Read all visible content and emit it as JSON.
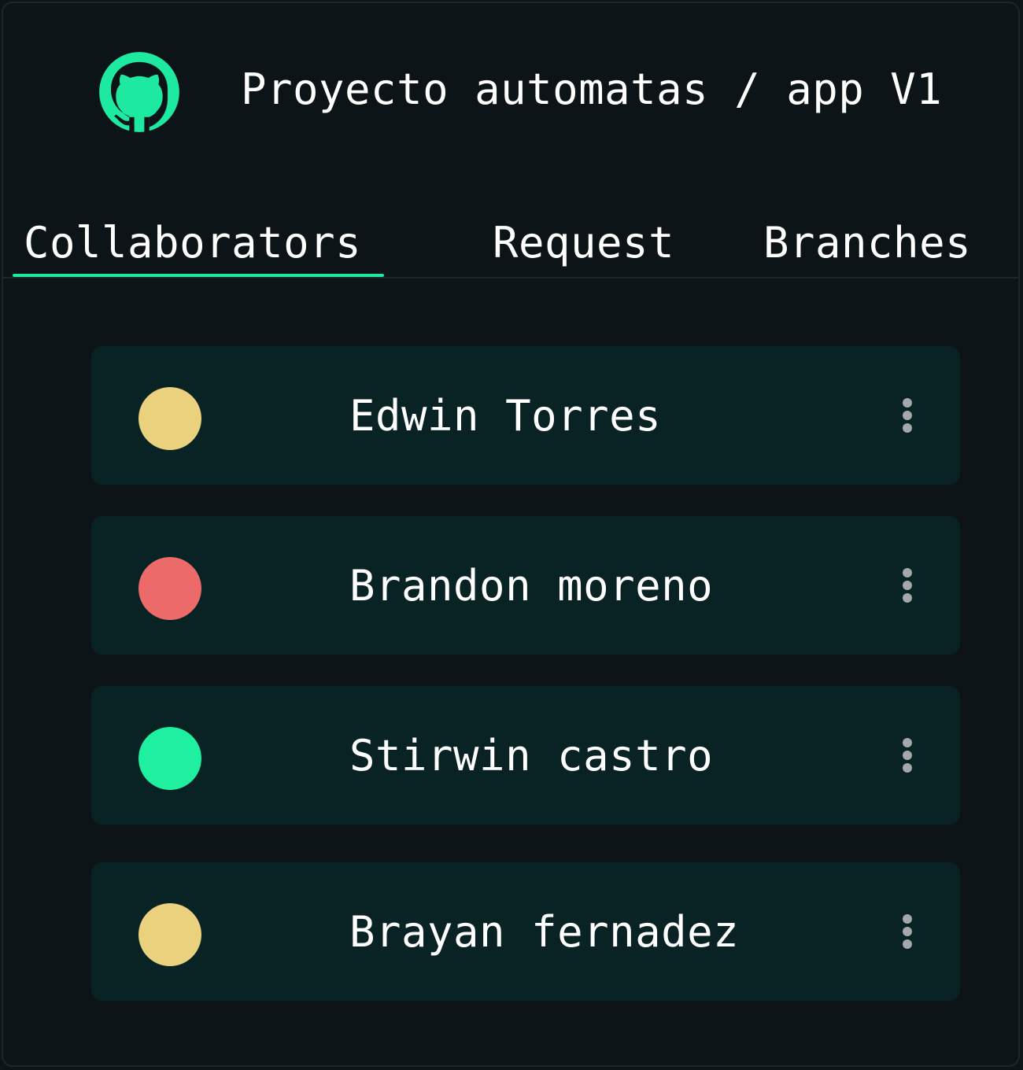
{
  "header": {
    "logo_icon": "github-icon",
    "title": "Proyecto automatas / app V1"
  },
  "tabs": [
    {
      "label": "Collaborators",
      "active": true
    },
    {
      "label": "Request",
      "active": false
    },
    {
      "label": "Branches",
      "active": false
    }
  ],
  "collaborators": [
    {
      "name": "Edwin Torres",
      "status_color": "#e9d17e"
    },
    {
      "name": "Brandon moreno",
      "status_color": "#ec6a6a"
    },
    {
      "name": "Stirwin castro",
      "status_color": "#1ff0a0"
    },
    {
      "name": "Brayan fernadez",
      "status_color": "#e9d17e"
    }
  ],
  "colors": {
    "accent": "#1de9a0",
    "background": "#0c1417",
    "card": "#092224"
  }
}
